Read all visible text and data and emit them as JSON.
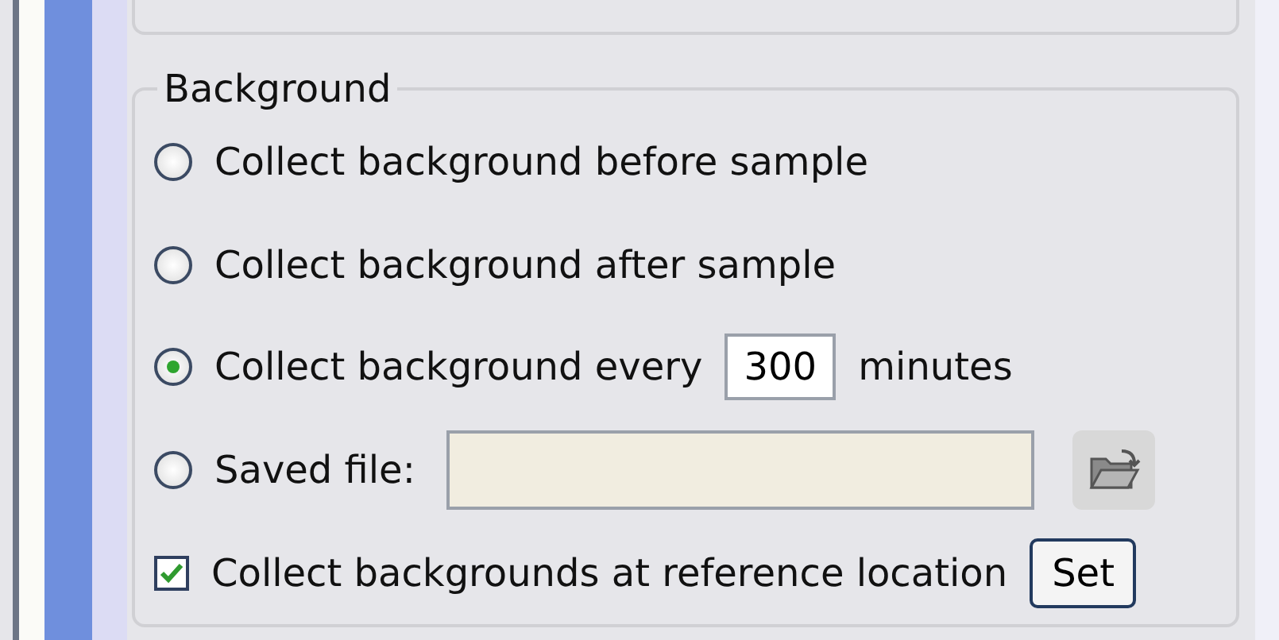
{
  "group": {
    "title": "Background"
  },
  "options": [
    {
      "kind": "plain",
      "label": "Collect background before sample",
      "selected": false
    },
    {
      "kind": "plain",
      "label": "Collect background after sample",
      "selected": false
    },
    {
      "kind": "interval",
      "label": "Collect background every",
      "value": "300",
      "unit": "minutes",
      "selected": true
    },
    {
      "kind": "file",
      "label": "Saved file:",
      "selected": false
    }
  ],
  "reference": {
    "label": "Collect backgrounds at reference location",
    "checked": true,
    "button": "Set"
  }
}
